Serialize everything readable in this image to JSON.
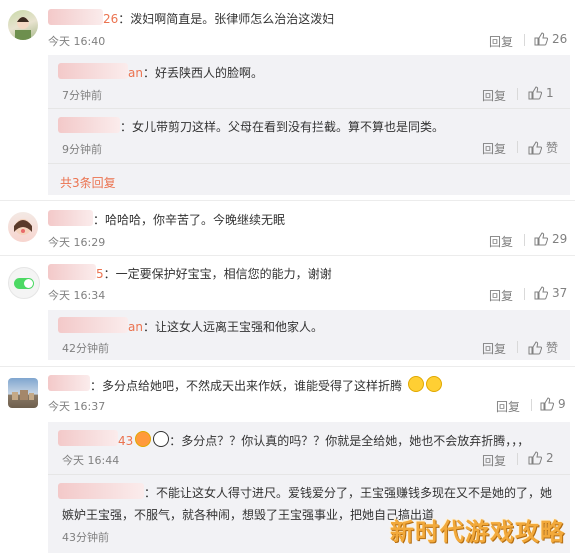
{
  "comments": [
    {
      "name_suffix": "26",
      "text": "：泼妇啊简直是。张律师怎么治治这泼妇",
      "time": "今天 16:40",
      "reply_label": "回复",
      "likes": "26",
      "replies": [
        {
          "name_suffix": "an",
          "text": "：好丢陕西人的脸啊。",
          "time": "7分钟前",
          "reply_label": "回复",
          "likes": "1"
        },
        {
          "name_suffix": "",
          "text": "：女儿带剪刀这样。父母在看到没有拦截。算不算也是同类。",
          "time": "9分钟前",
          "reply_label": "回复",
          "likes": "赞"
        }
      ],
      "more_label": "共3条回复"
    },
    {
      "name_suffix": "",
      "text": "：哈哈哈，你辛苦了。今晚继续无眠",
      "time": "今天 16:29",
      "reply_label": "回复",
      "likes": "29",
      "replies": []
    },
    {
      "name_suffix": "5",
      "text": "：一定要保护好宝宝，相信您的能力，谢谢",
      "time": "今天 16:34",
      "reply_label": "回复",
      "likes": "37",
      "replies": [
        {
          "name_suffix": "an",
          "text": "：让这女人远离王宝强和他家人。",
          "time": "42分钟前",
          "reply_label": "回复",
          "likes": "赞"
        }
      ]
    },
    {
      "name_suffix": "",
      "text": "：多分点给她吧，不然成天出来作妖，谁能受得了这样折腾",
      "time": "今天 16:37",
      "reply_label": "回复",
      "likes": "9",
      "replies": [
        {
          "name_suffix": "43",
          "text": "：多分点？？你认真的吗？？你就是全给她，她也不会放弃折腾，，，",
          "time": "今天 16:44",
          "reply_label": "回复",
          "likes": "2"
        },
        {
          "name_suffix": "",
          "text": "：不能让这女人得寸进尺。爱钱爱分了，王宝强赚钱多现在又不是她的了，她",
          "text2": "嫉妒王宝强，不服气，就各种闹，想毁了王宝强事业，把她自己搞出道",
          "time": "43分钟前",
          "reply_label": "回复",
          "likes": "赞"
        }
      ]
    }
  ],
  "watermark": "新时代游戏攻略",
  "colors": {
    "accent": "#eb7350",
    "meta": "#808080",
    "reply_bg": "#f2f2f5"
  }
}
